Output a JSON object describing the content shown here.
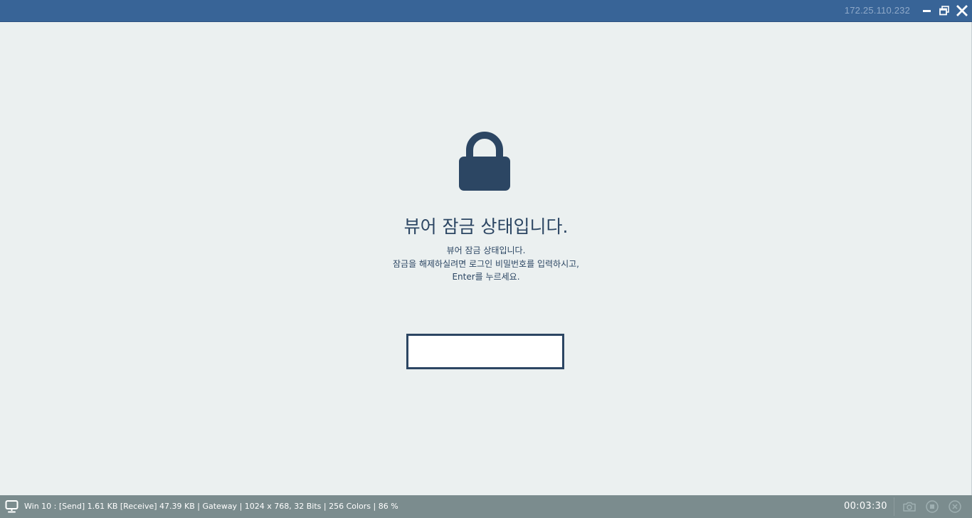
{
  "titlebar": {
    "ip_address": "172.25.110.232",
    "icons": {
      "minimize": "minimize-icon",
      "restore": "restore-icon",
      "close": "close-icon"
    }
  },
  "lock": {
    "icon": "lock-icon",
    "title": "뷰어 잠금 상태입니다.",
    "message_lines": [
      "뷰어 잠금 상태입니다.",
      "잠금을 해제하실려면 로그인 비밀번호를 입력하시고,",
      "Enter를 누르세요."
    ],
    "password_value": ""
  },
  "statusbar": {
    "info": "Win 10 : [Send] 1.61 KB  [Receive] 47.39 KB | Gateway | 1024 x 768, 32 Bits | 256 Colors | 86 %",
    "timer": "00:03:30",
    "icons": {
      "camera": "camera-icon",
      "record": "record-icon",
      "disconnect": "disconnect-icon"
    }
  },
  "colors": {
    "titlebar_bg": "#386497",
    "content_bg": "#ebf0f0",
    "lock_color": "#2c4663",
    "statusbar_bg": "#7b8c8e"
  }
}
